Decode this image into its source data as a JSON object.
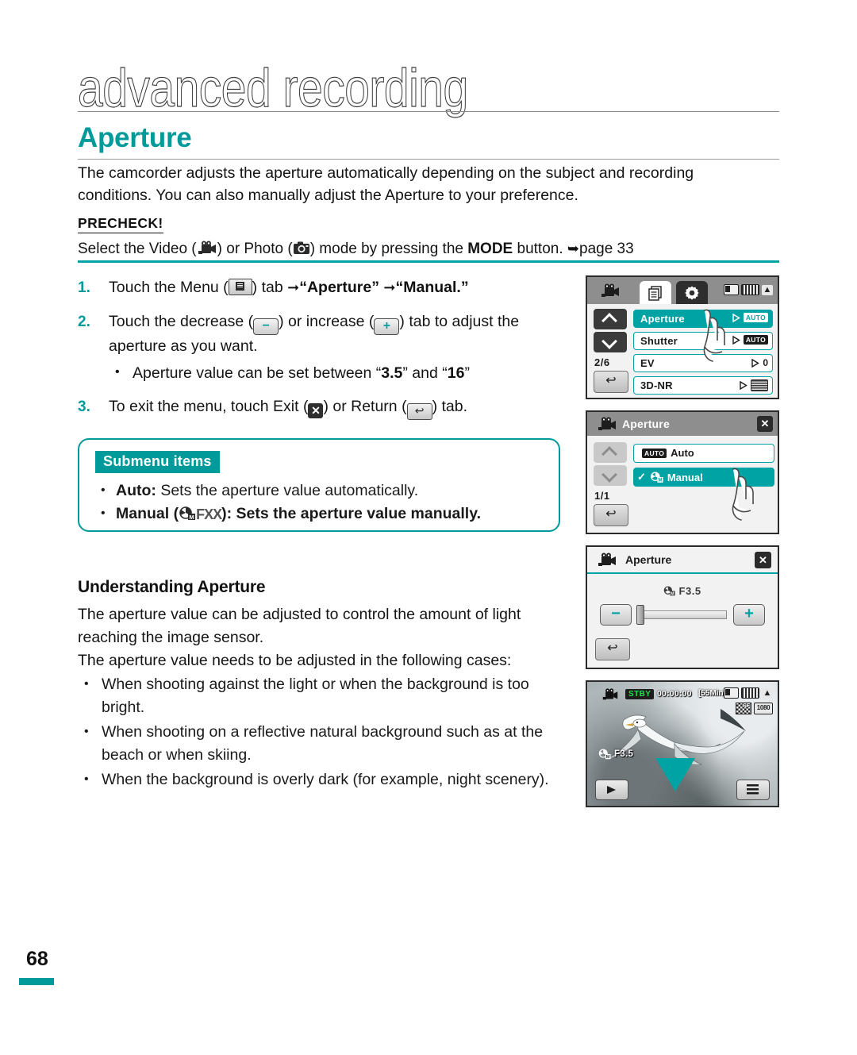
{
  "page": {
    "chapter_title": "advanced recording",
    "section_title": "Aperture",
    "page_number": "68",
    "accent_color": "#009a9a"
  },
  "intro": {
    "text": "The camcorder adjusts the aperture automatically depending on the subject and recording conditions. You can also manually adjust the Aperture to your preference."
  },
  "precheck": {
    "label": "PRECHECK!",
    "before_video": "Select the Video (",
    "after_video": ") or Photo (",
    "after_photo": ") mode by pressing the ",
    "mode_bold": "MODE",
    "tail": " button. ",
    "page_ref": "page 33"
  },
  "steps": [
    {
      "num": "1.",
      "a": "Touch the Menu (",
      "b": ") tab ",
      "target1": "“Aperture”",
      "target2": "“Manual.”"
    },
    {
      "num": "2.",
      "a": "Touch the decrease (",
      "minus": "−",
      "b": ") or increase (",
      "plus": "+",
      "c": ") tab to adjust the aperture as you want.",
      "bullet_a": "Aperture value can be set between “",
      "bullet_val1": "3.5",
      "bullet_b": "” and “",
      "bullet_val2": "16",
      "bullet_c": "”"
    },
    {
      "num": "3.",
      "a": "To exit the menu, touch Exit (",
      "exit_glyph": "✕",
      "b": ") or Return (",
      "return_glyph": "↩",
      "c": ") tab."
    }
  ],
  "submenu": {
    "tag": "Submenu items",
    "items": [
      {
        "name": "Auto:",
        "icons": "",
        "desc": " Sets the aperture value automatically."
      },
      {
        "name": "Manual (",
        "icons": "FXX",
        "desc": "): Sets the aperture value manually."
      }
    ]
  },
  "understanding": {
    "heading": "Understanding Aperture",
    "body1": "The aperture value can be adjusted to control the amount of light reaching the image sensor.",
    "body2": "The aperture value needs to be adjusted in the following cases:",
    "cases": [
      "When shooting against the light or when the background is too bright.",
      "When shooting on a reflective natural background such as at the beach or when skiing.",
      "When the background is overly dark (for example, night scenery)."
    ]
  },
  "panels": {
    "menu_panel": {
      "page_indicator": "2/6",
      "back_glyph": "↩",
      "rows": [
        {
          "label": "Aperture",
          "value": "AUTO",
          "selected": true
        },
        {
          "label": "Shutter",
          "value": "AUTO",
          "selected": false
        },
        {
          "label": "EV",
          "value": "0",
          "selected": false
        },
        {
          "label": "3D-NR",
          "value": "",
          "selected": false
        }
      ]
    },
    "submenu_panel": {
      "title": "Aperture",
      "close_glyph": "✕",
      "page_indicator": "1/1",
      "back_glyph": "↩",
      "rows": [
        {
          "label": "Auto",
          "badge": "AUTO",
          "selected": false,
          "checked": false
        },
        {
          "label": "Manual",
          "badge": "",
          "selected": true,
          "checked": true
        }
      ]
    },
    "adjust_panel": {
      "title": "Aperture",
      "close_glyph": "✕",
      "value": "F3.5",
      "minus": "−",
      "plus": "+",
      "back_glyph": "↩"
    },
    "live_panel": {
      "status": "STBY",
      "timecode": "00:00:00",
      "remaining": "[55Min]",
      "aperture": "F3.5",
      "quality": "SF",
      "resolution": "1080",
      "play_icon": "play-icon",
      "menu_icon": "menu-icon"
    }
  }
}
